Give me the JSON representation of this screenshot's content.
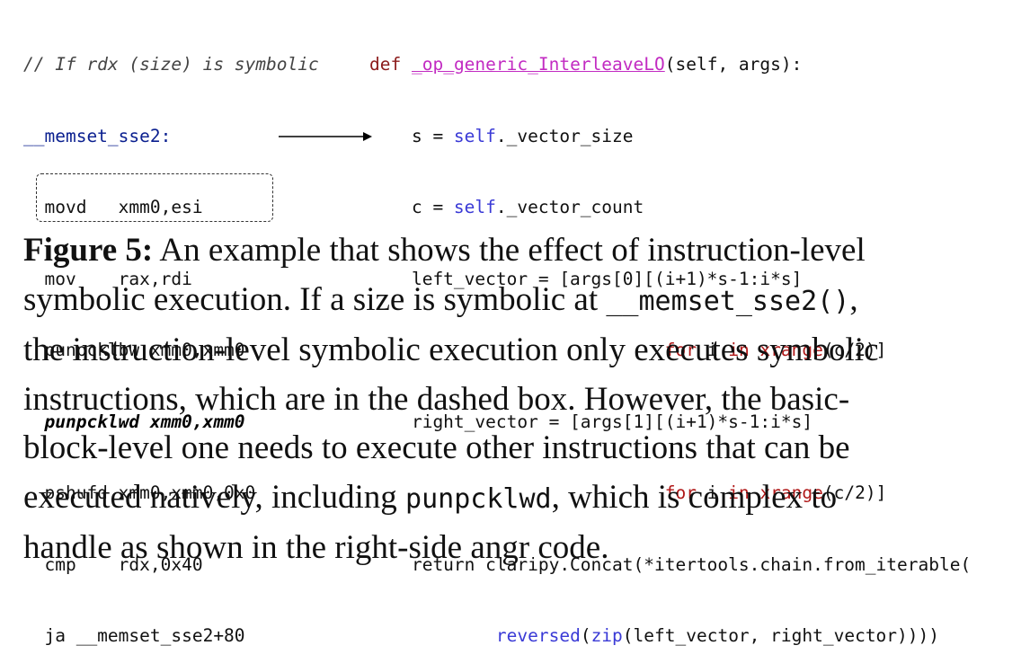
{
  "asm": {
    "comment": "// If rdx (size) is symbolic",
    "label": "__memset_sse2:",
    "lines": [
      "  movd   xmm0,esi",
      "  mov    rax,rdi",
      "  punpcklbw xmm0,xmm0"
    ],
    "bold_line": "  punpcklwd xmm0,xmm0",
    "after_bold": "  pshufd xmm0,xmm0,0x0",
    "boxed_lines": [
      "  cmp    rdx,0x40",
      "  ja __memset_sse2+80"
    ]
  },
  "python": {
    "def_kw": "def",
    "func_name": "_op_generic_InterleaveLO",
    "signature_rest": "(self, args):",
    "l2_pre": "    s = ",
    "l2_self": "self",
    "l2_post": "._vector_size",
    "l3_pre": "    c = ",
    "l3_self": "self",
    "l3_post": "._vector_count",
    "l4": "    left_vector = [args[0][(i+1)*s-1:i*s]",
    "l5_indent": "                            ",
    "for_kw": "for",
    "i_var": " i ",
    "in_kw": "in",
    "xrange_kw": "xrange",
    "xrange_args": "(c/2)]",
    "l6": "    right_vector = [args[1][(i+1)*s-1:i*s]",
    "l8": "    return claripy.Concat(*itertools.chain.from_iterable(",
    "l9_indent": "            ",
    "reversed_kw": "reversed",
    "zip_kw": "zip",
    "l9_rest": "(left_vector, right_vector))))"
  },
  "caption": {
    "label": "Figure 5:",
    "line1": " An example that shows the effect of instruction-level",
    "line2_pre": "symbolic execution. If a size is symbolic at ",
    "line2_code": "__memset_sse2()",
    "line2_post": ",",
    "line3": "the instruction-level symbolic execution only executes symbolic",
    "line4": "instructions, which are in the dashed box. However, the basic-",
    "line5": "block-level one needs to execute other instructions that can be",
    "line6_pre": "executed natively, including ",
    "line6_code": "punpcklwd",
    "line6_post": ", which is complex to",
    "line7": "handle as shown in the right-side angr code."
  }
}
